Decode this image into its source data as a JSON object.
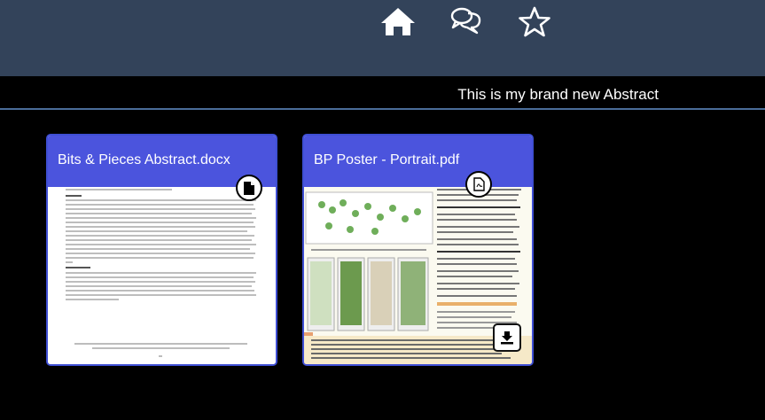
{
  "nav": {
    "icons": [
      "home-icon",
      "chat-icon",
      "star-icon"
    ]
  },
  "header": {
    "title": "This is my brand new Abstract"
  },
  "files": [
    {
      "name": "Bits & Pieces Abstract.docx",
      "type_icon": "document-icon"
    },
    {
      "name": "BP Poster - Portrait.pdf",
      "type_icon": "pdf-icon",
      "action_icon": "download-icon"
    }
  ],
  "colors": {
    "topbar": "#33435a",
    "card_header": "#4b54dd",
    "card_border": "#3f4fd4",
    "divider": "#4a6d99"
  }
}
